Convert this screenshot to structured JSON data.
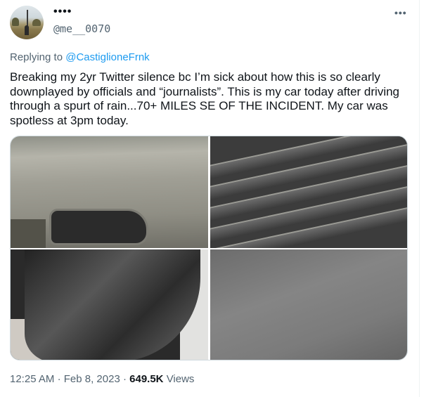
{
  "tweet": {
    "display_name": "••••",
    "handle": "@me__0070",
    "more_icon": "•••",
    "replying_prefix": "Replying to",
    "replying_to": "@CastiglioneFrnk",
    "text": "Breaking my 2yr Twitter silence bc I’m sick about how this is so clearly downplayed by officials and “journalists”. This is my car today after driving through a spurt of rain...70+ MILES SE OF THE INCIDENT. My car was spotless at 3pm today.",
    "time": "12:25 AM",
    "date": "Feb 8, 2023",
    "separator": "·",
    "views_count": "649.5K",
    "views_label": "Views"
  }
}
